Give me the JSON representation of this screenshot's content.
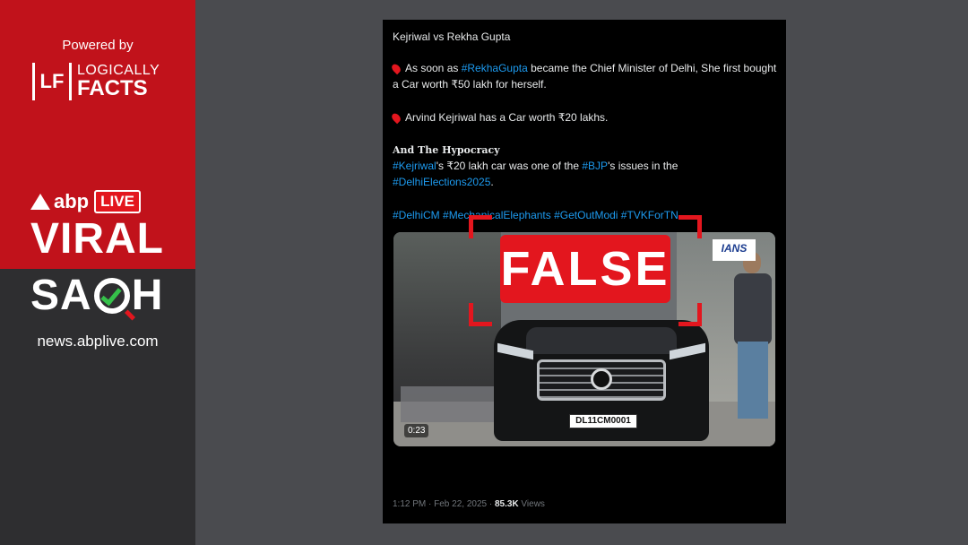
{
  "sidebar": {
    "powered_by": "Powered by",
    "lf_mark": "LF",
    "lf_line1": "LOGICALLY",
    "lf_line2": "FACTS",
    "abp": "abp",
    "live": "LIVE",
    "viral": "VIRAL",
    "sach_s": "SA",
    "sach_h": "H",
    "site": "news.abplive.com"
  },
  "tweet": {
    "title": "Kejriwal vs Rekha Gupta",
    "p1_pre": "As soon as ",
    "p1_tag": "#RekhaGupta",
    "p1_post": " became the Chief Minister of Delhi, She first bought a Car worth ₹50 lakh for herself.",
    "p2": "Arvind Kejriwal has a Car worth ₹20 lakhs.",
    "hypocracy": "And The Hypocracy",
    "p3_tag1": "#Kejriwal",
    "p3_mid": "'s ₹20 lakh car was one of the ",
    "p3_tag2": "#BJP",
    "p3_post": "'s issues in the ",
    "p3_tag3": "#DelhiElections2025",
    "p3_end": ".",
    "hashtags": "#DelhiCM #MechanicalElephants #GetOutModi #TVKForTN",
    "video": {
      "timecode": "0:23",
      "watermark": "IANS",
      "plate": "DL11CM0001"
    },
    "meta_time": "1:12 PM · Feb 22, 2025 · ",
    "views_count": "85.3K",
    "views_label": " Views"
  },
  "stamp": {
    "label": "FALSE",
    "color": "#e3161e"
  }
}
